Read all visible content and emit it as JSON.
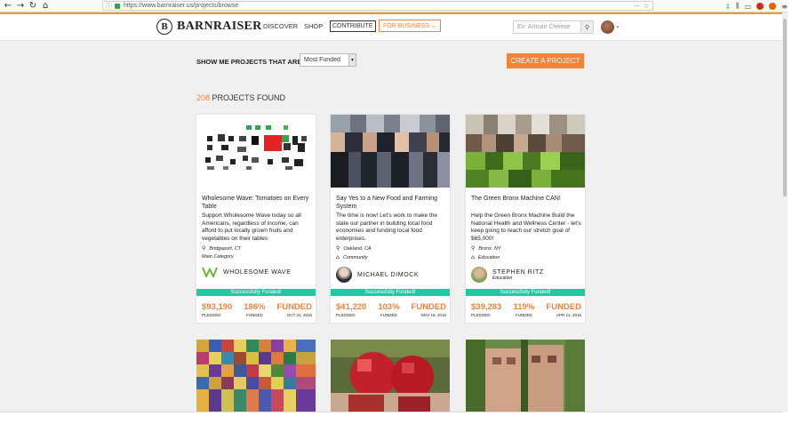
{
  "browser": {
    "url": "https://www.barnraiser.us/projects/browse",
    "back_icon": "back-arrow",
    "forward_icon": "forward-arrow",
    "reload_icon": "reload",
    "home_icon": "home",
    "url_more": "···",
    "star": "☆"
  },
  "header": {
    "logo_mark": "B",
    "logo_text": "BARNRAISER",
    "nav": {
      "discover": "DISCOVER",
      "shop": "SHOP",
      "contribute": "CONTRIBUTE",
      "for_business": "FOR BUSINESS ⌄"
    },
    "search_placeholder": "Ex: Artisan Cheese",
    "search_icon": "search-icon",
    "avatar_caret": "⌄"
  },
  "filter": {
    "label": "SHOW ME PROJECTS THAT ARE",
    "selected": "Most Funded",
    "create_button": "CREATE A PROJECT"
  },
  "results": {
    "count": "208",
    "label": "PROJECTS FOUND"
  },
  "cards": [
    {
      "title": "Wholesome Wave: Tomatoes on Every Table",
      "blurb": "Support Wholesome Wave today so all Americans, regardless of income, can afford to put locally grown fruits and vegetables on their tables",
      "location": "Bridgeport, CT",
      "category": "Main Category",
      "creator": "WHOLESOME WAVE",
      "creator_sub": "",
      "status": "Successfully Funded!",
      "pledged": "$93,190",
      "pledged_label": "PLEDGED",
      "funded_pct": "186%",
      "funded_label": "FUNDED",
      "state": "FUNDED",
      "date": "OCT 24, 2016"
    },
    {
      "title": "Say Yes to a New Food and Farming System",
      "blurb": "The time is now! Let's work to make the state our partner in building local food economies and funding local food enterprises.",
      "location": "Oakland, CA",
      "category": "Community",
      "creator": "MICHAEL DIMOCK",
      "creator_sub": "",
      "status": "Successfully Funded!",
      "pledged": "$41,220",
      "pledged_label": "PLEDGED",
      "funded_pct": "103%",
      "funded_label": "FUNDED",
      "state": "FUNDED",
      "date": "NOV 18, 2016"
    },
    {
      "title": "The Green Bronx Machine CAN!",
      "blurb": "Help the Green Bronx Machine Build the National Health and Wellness Center - let's keep going to reach our stretch goal of $65,000!",
      "location": "Bronx, NY",
      "category": "Education",
      "creator": "STEPHEN RITZ",
      "creator_sub": "Education",
      "status": "Successfully Funded!",
      "pledged": "$39,283",
      "pledged_label": "PLEDGED",
      "funded_pct": "119%",
      "funded_label": "FUNDED",
      "state": "FUNDED",
      "date": "APR 21, 2015"
    }
  ],
  "colors": {
    "accent": "#f4833a",
    "success": "#1fc9a3",
    "browser_highlight": "#f49a24"
  }
}
